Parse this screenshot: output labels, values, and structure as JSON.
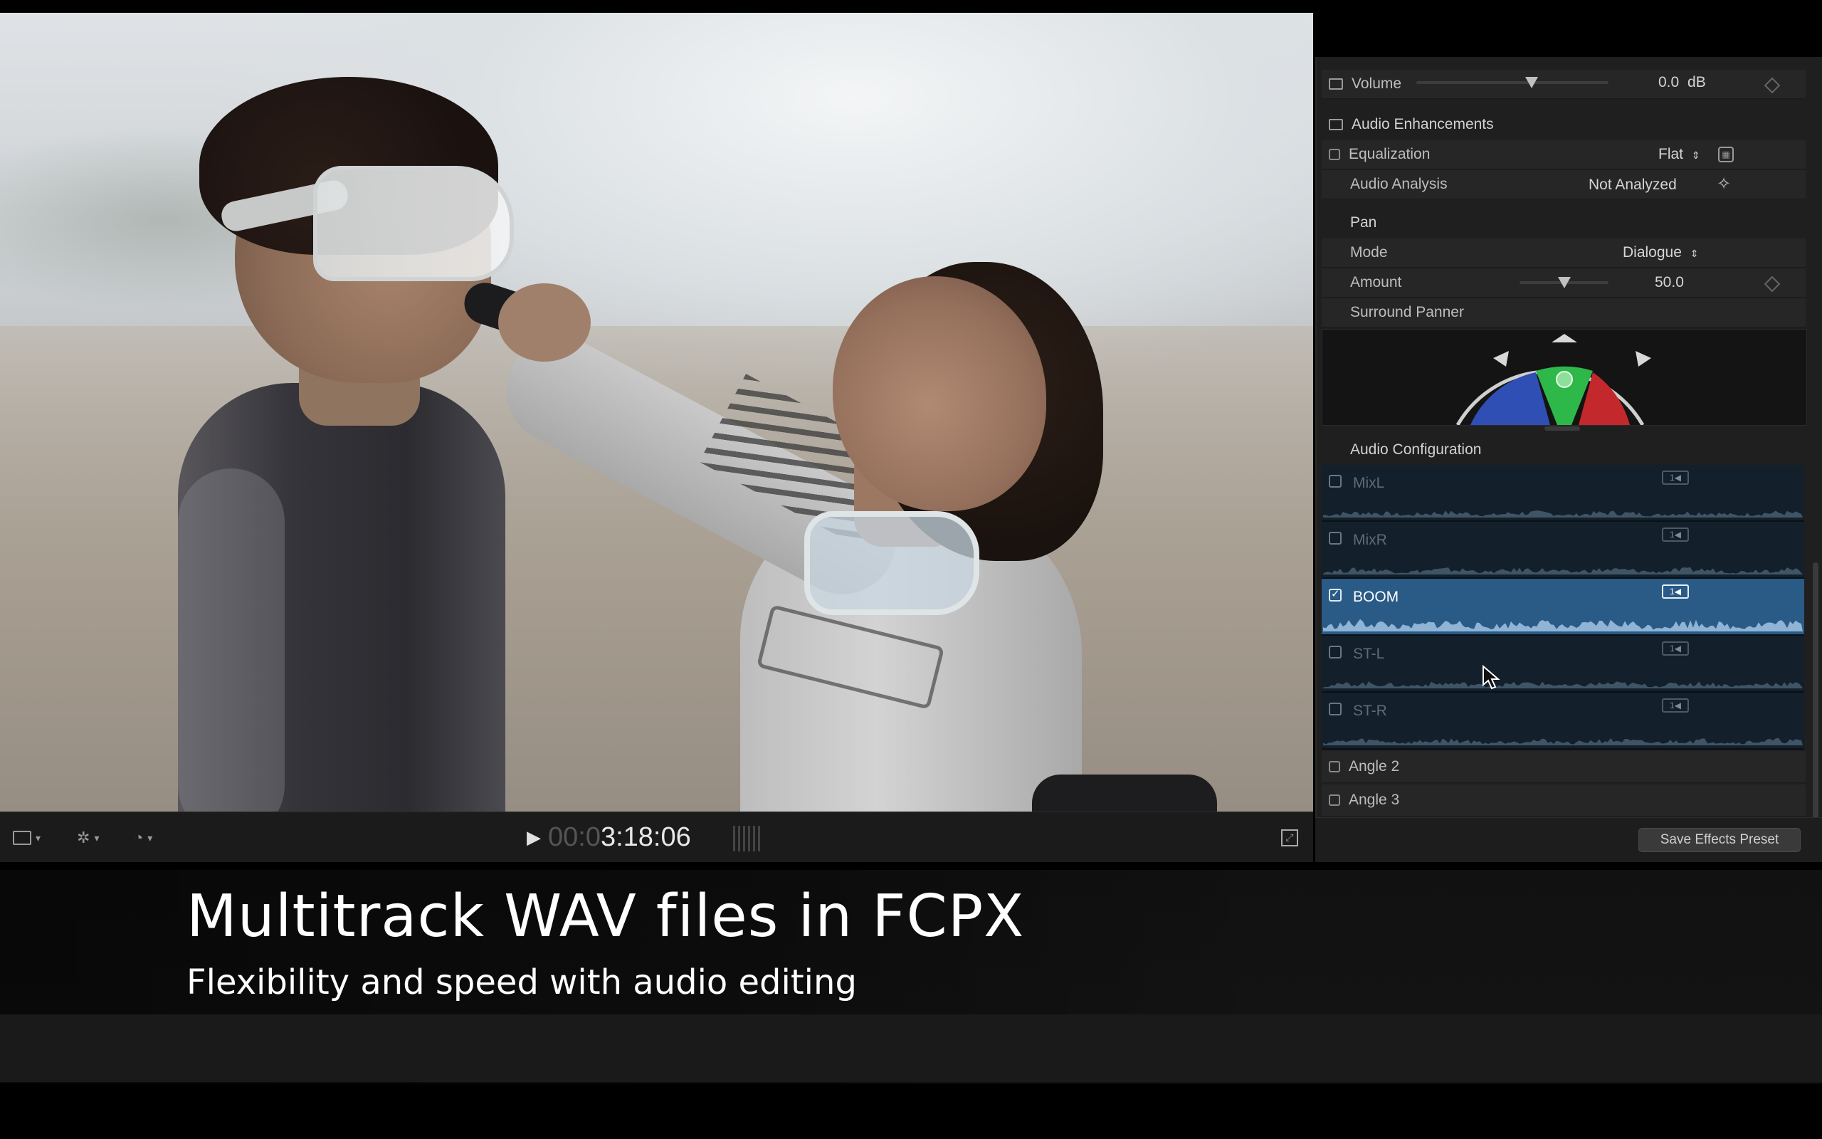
{
  "viewer": {
    "timecode_dim": "00:0",
    "timecode_main": "3:18:06"
  },
  "inspector": {
    "volume": {
      "label": "Volume",
      "value": "0.0",
      "unit": "dB",
      "level": 0.6
    },
    "audio_enhancements": {
      "label": "Audio Enhancements"
    },
    "equalization": {
      "label": "Equalization",
      "value": "Flat"
    },
    "audio_analysis": {
      "label": "Audio Analysis",
      "value": "Not Analyzed"
    },
    "pan": {
      "label": "Pan"
    },
    "mode": {
      "label": "Mode",
      "value": "Dialogue"
    },
    "amount": {
      "label": "Amount",
      "value": "50.0",
      "level": 0.5
    },
    "surround_panner": {
      "label": "Surround Panner"
    },
    "audio_configuration": {
      "label": "Audio Configuration"
    },
    "components": [
      {
        "label": "MixL",
        "checked": false,
        "channel": "1◀"
      },
      {
        "label": "MixR",
        "checked": false,
        "channel": "1◀"
      },
      {
        "label": "BOOM",
        "checked": true,
        "channel": "1◀"
      },
      {
        "label": "ST-L",
        "checked": false,
        "channel": "1◀"
      },
      {
        "label": "ST-R",
        "checked": false,
        "channel": "1◀"
      }
    ],
    "angles": [
      {
        "label": "Angle 2",
        "checked": false
      },
      {
        "label": "Angle 3",
        "checked": false
      }
    ],
    "save_preset": "Save Effects Preset"
  },
  "caption": {
    "title": "Multitrack WAV files in FCPX",
    "subtitle": "Flexibility and speed with audio editing"
  },
  "colors": {
    "selected_row": "#2a5a86",
    "panner_left": "#2f4fb5",
    "panner_center": "#2eb84a",
    "panner_right": "#c2282c"
  }
}
